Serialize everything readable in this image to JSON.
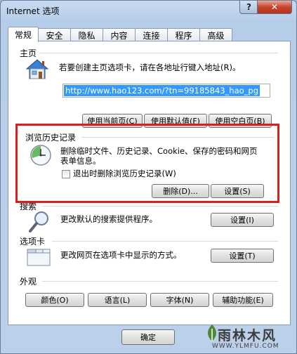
{
  "window": {
    "title": "Internet 选项",
    "help_label": "?",
    "close_label": "✕"
  },
  "tabs": [
    {
      "label": "常规"
    },
    {
      "label": "安全"
    },
    {
      "label": "隐私"
    },
    {
      "label": "内容"
    },
    {
      "label": "连接"
    },
    {
      "label": "程序"
    },
    {
      "label": "高级"
    }
  ],
  "homepage": {
    "title": "主页",
    "description": "若要创建主页选项卡，请在各地址行键入地址(R)。",
    "url": "http://www.hao123.com/?tn=99185843_hao_pg",
    "use_current": "使用当前页(C)",
    "use_default": "使用默认值(F)",
    "use_blank": "使用空白页(B)"
  },
  "history": {
    "title": "浏览历史记录",
    "description_line1": "删除临时文件、历史记录、Cookie、保存的密码和网页",
    "description_line2": "表单信息。",
    "checkbox_label": "退出时删除浏览历史记录(W)",
    "delete_label": "删除(D)...",
    "settings_label": "设置(S)"
  },
  "search": {
    "title": "搜索",
    "description": "更改默认的搜索提供程序。",
    "settings_label": "设置(I)"
  },
  "tabs_section": {
    "title": "选项卡",
    "description": "更改网页在选项卡中显示的方式。",
    "settings_label": "设置(T)"
  },
  "appearance": {
    "title": "外观",
    "colors": "颜色(O)",
    "languages": "语言(L)",
    "fonts": "字体(N)",
    "accessibility": "辅助功能(E)"
  },
  "footer": {
    "ok_label": "确定"
  },
  "watermark": {
    "text": "雨林木风",
    "url": "WWW.YLMFU.COM"
  }
}
